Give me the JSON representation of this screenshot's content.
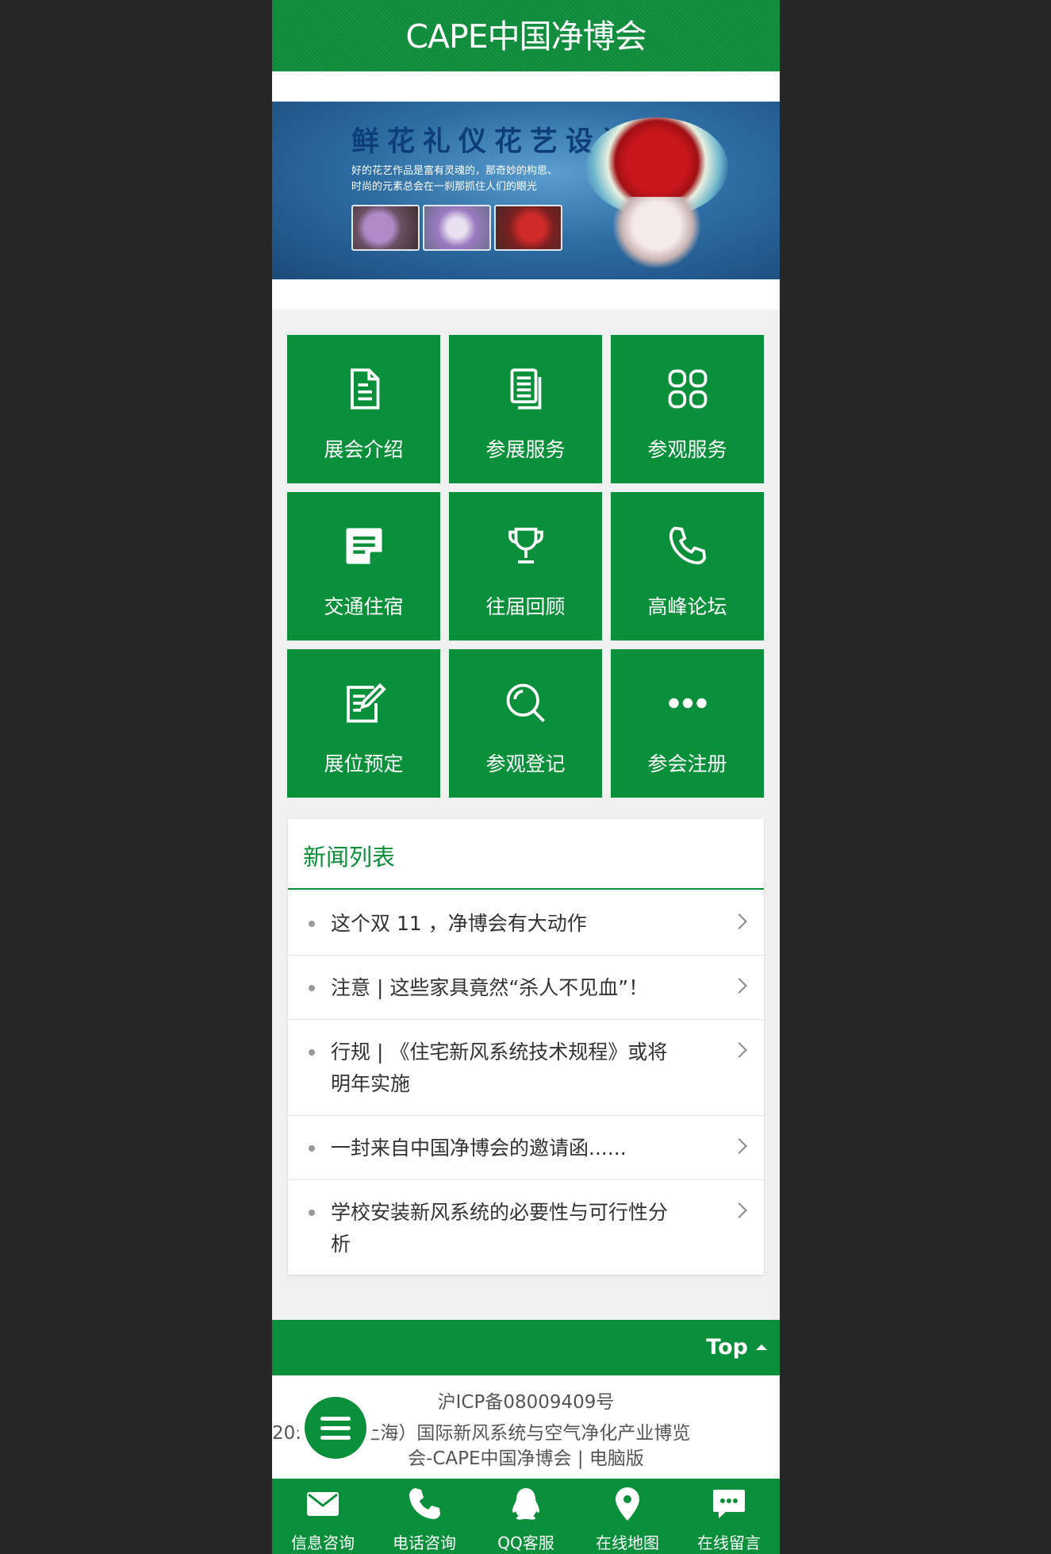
{
  "header": {
    "title": "CAPE中国净博会"
  },
  "banner": {
    "title": "鲜花礼仪花艺设计",
    "subtitle_line1": "好的花艺作品是富有灵魂的，那奇妙的构思、",
    "subtitle_line2": "时尚的元素总会在一刹那抓住人们的眼光",
    "slide_count": 2,
    "active_slide": 2
  },
  "grid": {
    "items": [
      {
        "label": "展会介绍",
        "icon": "document-icon"
      },
      {
        "label": "参展服务",
        "icon": "file-stack-icon"
      },
      {
        "label": "参观服务",
        "icon": "apps-icon"
      },
      {
        "label": "交通住宿",
        "icon": "note-icon"
      },
      {
        "label": "往届回顾",
        "icon": "trophy-icon"
      },
      {
        "label": "高峰论坛",
        "icon": "phone-icon"
      },
      {
        "label": "展位预定",
        "icon": "edit-icon"
      },
      {
        "label": "参观登记",
        "icon": "search-icon"
      },
      {
        "label": "参会注册",
        "icon": "more-icon"
      }
    ]
  },
  "news": {
    "title": "新闻列表",
    "items": [
      {
        "line1": "这个双 11 ，净博会有大动作",
        "line2": ""
      },
      {
        "line1": "注意 | 这些家具竟然“杀人不见血”！",
        "line2": ""
      },
      {
        "line1": "行规 | 《住宅新风系统技术规程》或将",
        "line2": "明年实施"
      },
      {
        "line1": "一封来自中国净博会的邀请函......",
        "line2": ""
      },
      {
        "line1": "学校安装新风系统的必要性与可行性分",
        "line2": "析"
      }
    ]
  },
  "footer": {
    "top_label": "Top",
    "icp": "沪ICP备08009409号",
    "copyright_line1": "20:    中国（上海）国际新风系统与空气净化产业博览",
    "copyright_line2": "会-CAPE中国净博会   |   电脑版"
  },
  "bottom_nav": {
    "items": [
      {
        "label": "信息咨询",
        "icon": "mail-icon"
      },
      {
        "label": "电话咨询",
        "icon": "phone-icon"
      },
      {
        "label": "QQ客服",
        "icon": "qq-icon"
      },
      {
        "label": "在线地图",
        "icon": "map-pin-icon"
      },
      {
        "label": "在线留言",
        "icon": "message-icon"
      }
    ]
  },
  "colors": {
    "brand_green": "#0a8f3a",
    "page_bg": "#262626",
    "content_bg": "#f0f0f0"
  }
}
